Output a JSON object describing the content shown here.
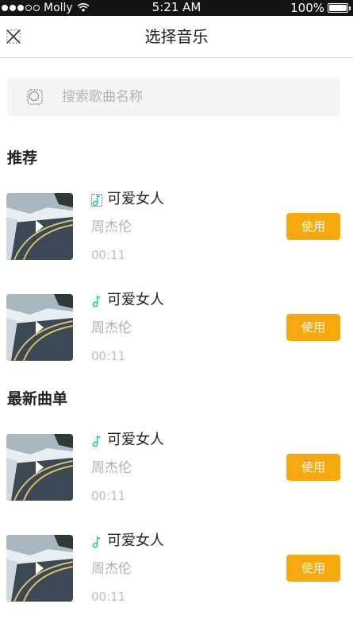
{
  "status_bar": {
    "carrier": "Molly",
    "time": "5:21 AM",
    "battery": "100%",
    "signal_bars_filled": 3,
    "signal_bars_total": 5
  },
  "header": {
    "title": "选择音乐",
    "close_icon": "close-icon"
  },
  "search": {
    "placeholder": "搜索歌曲名称",
    "icon": "search-icon"
  },
  "sections": [
    {
      "title": "推荐",
      "songs": [
        {
          "title": "可爱女人",
          "artist": "周杰伦",
          "duration": "00:11",
          "action": "使用"
        },
        {
          "title": "可爱女人",
          "artist": "周杰伦",
          "duration": "00:11",
          "action": "使用"
        }
      ]
    },
    {
      "title": "最新曲单",
      "songs": [
        {
          "title": "可爱女人",
          "artist": "周杰伦",
          "duration": "00:11",
          "action": "使用"
        },
        {
          "title": "可爱女人",
          "artist": "周杰伦",
          "duration": "00:11",
          "action": "使用"
        }
      ]
    }
  ],
  "colors": {
    "accent": "#f7a90f",
    "note_icon": "#1fbfae",
    "status_bar": "#141414"
  }
}
